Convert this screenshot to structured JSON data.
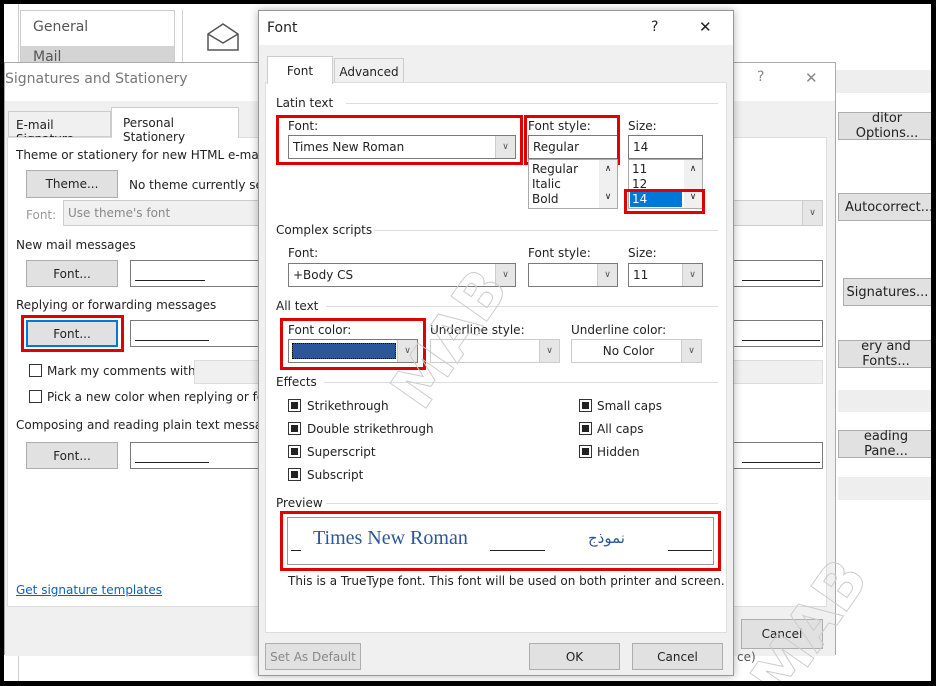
{
  "options_bg": {
    "nav": [
      "General",
      "Mail"
    ],
    "buttons": [
      "ditor Options...",
      "Autocorrect...",
      "Signatures...",
      "ery and Fonts...",
      "eading Pane..."
    ]
  },
  "sig_dialog": {
    "title": "Signatures and Stationery",
    "help": "?",
    "close": "✕",
    "tabs": [
      "E-mail Signature",
      "Personal Stationery"
    ],
    "theme_label": "Theme or stationery for new HTML e-mail me",
    "theme_button": "Theme...",
    "theme_status": "No theme currently selec",
    "font_label": "Font:",
    "font_value": "Use theme's font",
    "new_mail": "New mail messages",
    "replying": "Replying or forwarding messages",
    "mark_comments": "Mark my comments with:",
    "pick_color": "Pick a new color when replying or forwa",
    "plain_text": "Composing and reading plain text messages",
    "font_button": "Font...",
    "link": "Get signature templates",
    "cancel": "Cancel",
    "footer_frag": "ce)"
  },
  "font_dialog": {
    "title": "Font",
    "help": "?",
    "close": "✕",
    "tabs": [
      "Font",
      "Advanced"
    ],
    "latin": {
      "heading": "Latin text",
      "font_label": "Font:",
      "font_value": "Times New Roman",
      "style_label": "Font style:",
      "style_value": "Regular",
      "style_list": [
        "Regular",
        "Italic",
        "Bold"
      ],
      "size_label": "Size:",
      "size_value": "14",
      "size_list": [
        "11",
        "12",
        "14"
      ]
    },
    "complex": {
      "heading": "Complex scripts",
      "font_label": "Font:",
      "font_value": "+Body CS",
      "style_label": "Font style:",
      "style_value": "",
      "size_label": "Size:",
      "size_value": "11"
    },
    "all_text": {
      "heading": "All text",
      "color_label": "Font color:",
      "color_value": "#2b579a",
      "underline_label": "Underline style:",
      "underline_color_label": "Underline color:",
      "underline_color_value": "No Color"
    },
    "effects": {
      "heading": "Effects",
      "left": [
        "Strikethrough",
        "Double strikethrough",
        "Superscript",
        "Subscript"
      ],
      "right": [
        "Small caps",
        "All caps",
        "Hidden"
      ]
    },
    "preview": {
      "heading": "Preview",
      "latin_sample": "Times New Roman",
      "arabic_sample": "نموذج",
      "note": "This is a TrueType font. This font will be used on both printer and screen."
    },
    "set_default": "Set As Default",
    "ok": "OK",
    "cancel": "Cancel"
  },
  "watermark": "MAB",
  "colors": {
    "highlight": "#e00000",
    "selection": "#0078d7",
    "link": "#0563c1"
  }
}
